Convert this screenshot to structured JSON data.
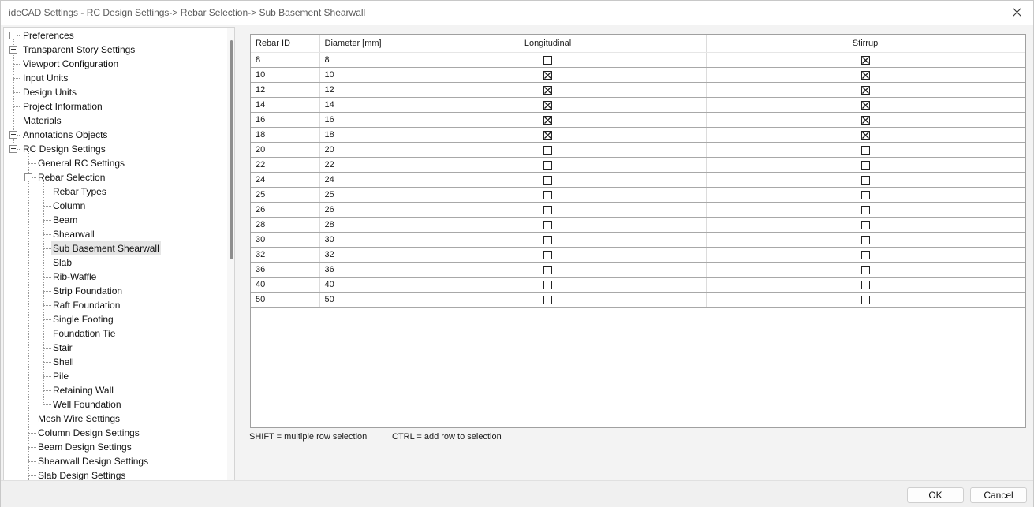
{
  "window": {
    "title": "ideCAD Settings - RC Design Settings-> Rebar Selection-> Sub Basement Shearwall"
  },
  "tree": [
    {
      "label": "Preferences",
      "level": 0,
      "expander": "plus"
    },
    {
      "label": "Transparent Story Settings",
      "level": 0,
      "expander": "plus"
    },
    {
      "label": "Viewport Configuration",
      "level": 0
    },
    {
      "label": "Input Units",
      "level": 0
    },
    {
      "label": "Design Units",
      "level": 0
    },
    {
      "label": "Project Information",
      "level": 0
    },
    {
      "label": "Materials",
      "level": 0
    },
    {
      "label": "Annotations Objects",
      "level": 0,
      "expander": "plus"
    },
    {
      "label": "RC Design Settings",
      "level": 0,
      "expander": "minus"
    },
    {
      "label": "General RC Settings",
      "level": 1
    },
    {
      "label": "Rebar Selection",
      "level": 1,
      "expander": "minus"
    },
    {
      "label": "Rebar Types",
      "level": 2
    },
    {
      "label": "Column",
      "level": 2
    },
    {
      "label": "Beam",
      "level": 2
    },
    {
      "label": "Shearwall",
      "level": 2
    },
    {
      "label": "Sub Basement Shearwall",
      "level": 2,
      "selected": true
    },
    {
      "label": "Slab",
      "level": 2
    },
    {
      "label": "Rib-Waffle",
      "level": 2
    },
    {
      "label": "Strip Foundation",
      "level": 2
    },
    {
      "label": "Raft Foundation",
      "level": 2
    },
    {
      "label": "Single Footing",
      "level": 2
    },
    {
      "label": "Foundation Tie",
      "level": 2
    },
    {
      "label": "Stair",
      "level": 2
    },
    {
      "label": "Shell",
      "level": 2
    },
    {
      "label": "Pile",
      "level": 2
    },
    {
      "label": "Retaining Wall",
      "level": 2
    },
    {
      "label": "Well Foundation",
      "level": 2
    },
    {
      "label": "Mesh Wire Settings",
      "level": 1
    },
    {
      "label": "Column Design Settings",
      "level": 1
    },
    {
      "label": "Beam Design Settings",
      "level": 1
    },
    {
      "label": "Shearwall Design Settings",
      "level": 1
    },
    {
      "label": "Slab Design Settings",
      "level": 1
    }
  ],
  "table": {
    "columns": [
      "Rebar ID",
      "Diameter [mm]",
      "Longitudinal",
      "Stirrup"
    ],
    "rows": [
      {
        "id": "8",
        "diameter": "8",
        "longitudinal": false,
        "stirrup": true
      },
      {
        "id": "10",
        "diameter": "10",
        "longitudinal": true,
        "stirrup": true
      },
      {
        "id": "12",
        "diameter": "12",
        "longitudinal": true,
        "stirrup": true
      },
      {
        "id": "14",
        "diameter": "14",
        "longitudinal": true,
        "stirrup": true
      },
      {
        "id": "16",
        "diameter": "16",
        "longitudinal": true,
        "stirrup": true
      },
      {
        "id": "18",
        "diameter": "18",
        "longitudinal": true,
        "stirrup": true
      },
      {
        "id": "20",
        "diameter": "20",
        "longitudinal": false,
        "stirrup": false
      },
      {
        "id": "22",
        "diameter": "22",
        "longitudinal": false,
        "stirrup": false
      },
      {
        "id": "24",
        "diameter": "24",
        "longitudinal": false,
        "stirrup": false
      },
      {
        "id": "25",
        "diameter": "25",
        "longitudinal": false,
        "stirrup": false
      },
      {
        "id": "26",
        "diameter": "26",
        "longitudinal": false,
        "stirrup": false
      },
      {
        "id": "28",
        "diameter": "28",
        "longitudinal": false,
        "stirrup": false
      },
      {
        "id": "30",
        "diameter": "30",
        "longitudinal": false,
        "stirrup": false
      },
      {
        "id": "32",
        "diameter": "32",
        "longitudinal": false,
        "stirrup": false
      },
      {
        "id": "36",
        "diameter": "36",
        "longitudinal": false,
        "stirrup": false
      },
      {
        "id": "40",
        "diameter": "40",
        "longitudinal": false,
        "stirrup": false
      },
      {
        "id": "50",
        "diameter": "50",
        "longitudinal": false,
        "stirrup": false
      }
    ]
  },
  "hints": {
    "shift": "SHIFT = multiple row selection",
    "ctrl": "CTRL = add row to selection"
  },
  "buttons": {
    "ok": "OK",
    "cancel": "Cancel"
  }
}
